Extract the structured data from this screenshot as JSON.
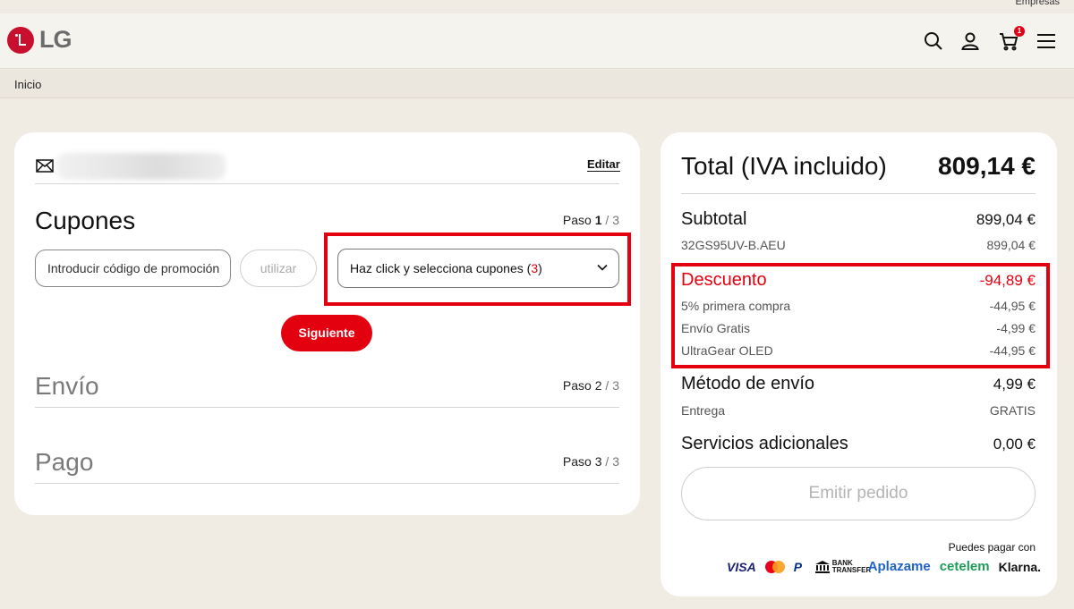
{
  "top": {
    "empresas": "Empresas"
  },
  "header": {
    "logo_text": "LG",
    "cart_count": "1",
    "icons": [
      "search-icon",
      "user-icon",
      "cart-icon",
      "menu-icon"
    ]
  },
  "breadcrumb": {
    "home": "Inicio"
  },
  "account": {
    "edit_label": "Editar"
  },
  "steps": [
    {
      "title": "Cupones",
      "label": "Paso",
      "current": "1",
      "total": "/ 3"
    },
    {
      "title": "Envío",
      "label": "Paso",
      "current": "2",
      "total": "/ 3"
    },
    {
      "title": "Pago",
      "label": "Paso",
      "current": "3",
      "total": "/ 3"
    }
  ],
  "coupons": {
    "promo_placeholder": "Introducir código de promoción",
    "use_label": "utilizar",
    "select_label": "Haz click y selecciona cupones (",
    "select_count": "3",
    "select_close": ")",
    "next_label": "Siguiente"
  },
  "summary": {
    "total_label": "Total (IVA incluido)",
    "total_value": "809,14 €",
    "subtotal_label": "Subtotal",
    "subtotal_value": "899,04 €",
    "product_label": "32GS95UV-B.AEU",
    "product_value": "899,04 €",
    "discount_label": "Descuento",
    "discount_value": "-94,89 €",
    "discounts": [
      {
        "label": "5% primera compra",
        "value": "-44,95 €"
      },
      {
        "label": "Envío Gratis",
        "value": "-4,99 €"
      },
      {
        "label": "UltraGear OLED",
        "value": "-44,95 €"
      }
    ],
    "shipping_label": "Método de envío",
    "shipping_value": "4,99 €",
    "delivery_label": "Entrega",
    "delivery_value": "GRATIS",
    "services_label": "Servicios adicionales",
    "services_value": "0,00 €",
    "order_label": "Emitir pedido",
    "pay_label": "Puedes pagar con",
    "payment_methods": [
      "VISA",
      "Mastercard",
      "PayPal",
      "BANK TRANSFER",
      "Aplazame",
      "cetelem",
      "Klarna."
    ]
  },
  "colors": {
    "accent": "#e3000f",
    "lg_red": "#c8102e",
    "background": "#f0ece4"
  }
}
